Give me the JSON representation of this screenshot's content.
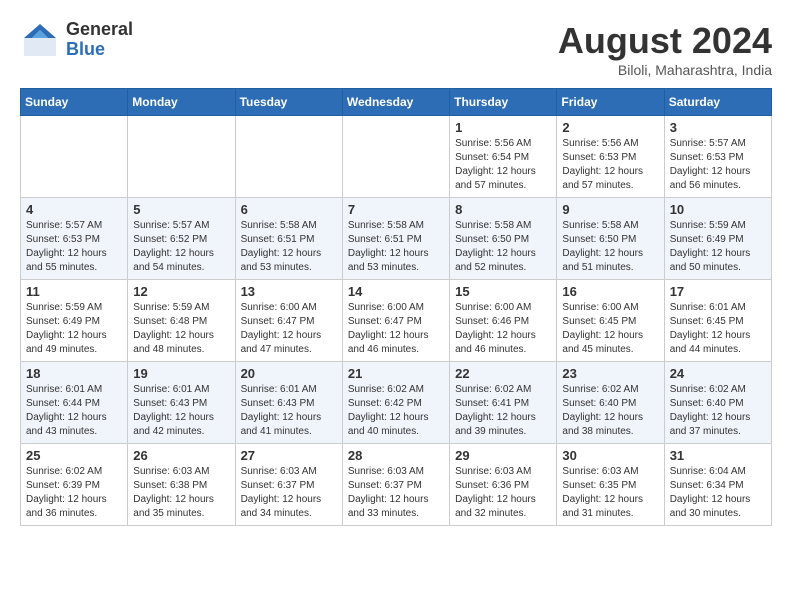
{
  "header": {
    "logo_general": "General",
    "logo_blue": "Blue",
    "main_title": "August 2024",
    "subtitle": "Biloli, Maharashtra, India"
  },
  "calendar": {
    "days_of_week": [
      "Sunday",
      "Monday",
      "Tuesday",
      "Wednesday",
      "Thursday",
      "Friday",
      "Saturday"
    ],
    "weeks": [
      [
        {
          "day": "",
          "info": ""
        },
        {
          "day": "",
          "info": ""
        },
        {
          "day": "",
          "info": ""
        },
        {
          "day": "",
          "info": ""
        },
        {
          "day": "1",
          "info": "Sunrise: 5:56 AM\nSunset: 6:54 PM\nDaylight: 12 hours\nand 57 minutes."
        },
        {
          "day": "2",
          "info": "Sunrise: 5:56 AM\nSunset: 6:53 PM\nDaylight: 12 hours\nand 57 minutes."
        },
        {
          "day": "3",
          "info": "Sunrise: 5:57 AM\nSunset: 6:53 PM\nDaylight: 12 hours\nand 56 minutes."
        }
      ],
      [
        {
          "day": "4",
          "info": "Sunrise: 5:57 AM\nSunset: 6:53 PM\nDaylight: 12 hours\nand 55 minutes."
        },
        {
          "day": "5",
          "info": "Sunrise: 5:57 AM\nSunset: 6:52 PM\nDaylight: 12 hours\nand 54 minutes."
        },
        {
          "day": "6",
          "info": "Sunrise: 5:58 AM\nSunset: 6:51 PM\nDaylight: 12 hours\nand 53 minutes."
        },
        {
          "day": "7",
          "info": "Sunrise: 5:58 AM\nSunset: 6:51 PM\nDaylight: 12 hours\nand 53 minutes."
        },
        {
          "day": "8",
          "info": "Sunrise: 5:58 AM\nSunset: 6:50 PM\nDaylight: 12 hours\nand 52 minutes."
        },
        {
          "day": "9",
          "info": "Sunrise: 5:58 AM\nSunset: 6:50 PM\nDaylight: 12 hours\nand 51 minutes."
        },
        {
          "day": "10",
          "info": "Sunrise: 5:59 AM\nSunset: 6:49 PM\nDaylight: 12 hours\nand 50 minutes."
        }
      ],
      [
        {
          "day": "11",
          "info": "Sunrise: 5:59 AM\nSunset: 6:49 PM\nDaylight: 12 hours\nand 49 minutes."
        },
        {
          "day": "12",
          "info": "Sunrise: 5:59 AM\nSunset: 6:48 PM\nDaylight: 12 hours\nand 48 minutes."
        },
        {
          "day": "13",
          "info": "Sunrise: 6:00 AM\nSunset: 6:47 PM\nDaylight: 12 hours\nand 47 minutes."
        },
        {
          "day": "14",
          "info": "Sunrise: 6:00 AM\nSunset: 6:47 PM\nDaylight: 12 hours\nand 46 minutes."
        },
        {
          "day": "15",
          "info": "Sunrise: 6:00 AM\nSunset: 6:46 PM\nDaylight: 12 hours\nand 46 minutes."
        },
        {
          "day": "16",
          "info": "Sunrise: 6:00 AM\nSunset: 6:45 PM\nDaylight: 12 hours\nand 45 minutes."
        },
        {
          "day": "17",
          "info": "Sunrise: 6:01 AM\nSunset: 6:45 PM\nDaylight: 12 hours\nand 44 minutes."
        }
      ],
      [
        {
          "day": "18",
          "info": "Sunrise: 6:01 AM\nSunset: 6:44 PM\nDaylight: 12 hours\nand 43 minutes."
        },
        {
          "day": "19",
          "info": "Sunrise: 6:01 AM\nSunset: 6:43 PM\nDaylight: 12 hours\nand 42 minutes."
        },
        {
          "day": "20",
          "info": "Sunrise: 6:01 AM\nSunset: 6:43 PM\nDaylight: 12 hours\nand 41 minutes."
        },
        {
          "day": "21",
          "info": "Sunrise: 6:02 AM\nSunset: 6:42 PM\nDaylight: 12 hours\nand 40 minutes."
        },
        {
          "day": "22",
          "info": "Sunrise: 6:02 AM\nSunset: 6:41 PM\nDaylight: 12 hours\nand 39 minutes."
        },
        {
          "day": "23",
          "info": "Sunrise: 6:02 AM\nSunset: 6:40 PM\nDaylight: 12 hours\nand 38 minutes."
        },
        {
          "day": "24",
          "info": "Sunrise: 6:02 AM\nSunset: 6:40 PM\nDaylight: 12 hours\nand 37 minutes."
        }
      ],
      [
        {
          "day": "25",
          "info": "Sunrise: 6:02 AM\nSunset: 6:39 PM\nDaylight: 12 hours\nand 36 minutes."
        },
        {
          "day": "26",
          "info": "Sunrise: 6:03 AM\nSunset: 6:38 PM\nDaylight: 12 hours\nand 35 minutes."
        },
        {
          "day": "27",
          "info": "Sunrise: 6:03 AM\nSunset: 6:37 PM\nDaylight: 12 hours\nand 34 minutes."
        },
        {
          "day": "28",
          "info": "Sunrise: 6:03 AM\nSunset: 6:37 PM\nDaylight: 12 hours\nand 33 minutes."
        },
        {
          "day": "29",
          "info": "Sunrise: 6:03 AM\nSunset: 6:36 PM\nDaylight: 12 hours\nand 32 minutes."
        },
        {
          "day": "30",
          "info": "Sunrise: 6:03 AM\nSunset: 6:35 PM\nDaylight: 12 hours\nand 31 minutes."
        },
        {
          "day": "31",
          "info": "Sunrise: 6:04 AM\nSunset: 6:34 PM\nDaylight: 12 hours\nand 30 minutes."
        }
      ]
    ]
  }
}
